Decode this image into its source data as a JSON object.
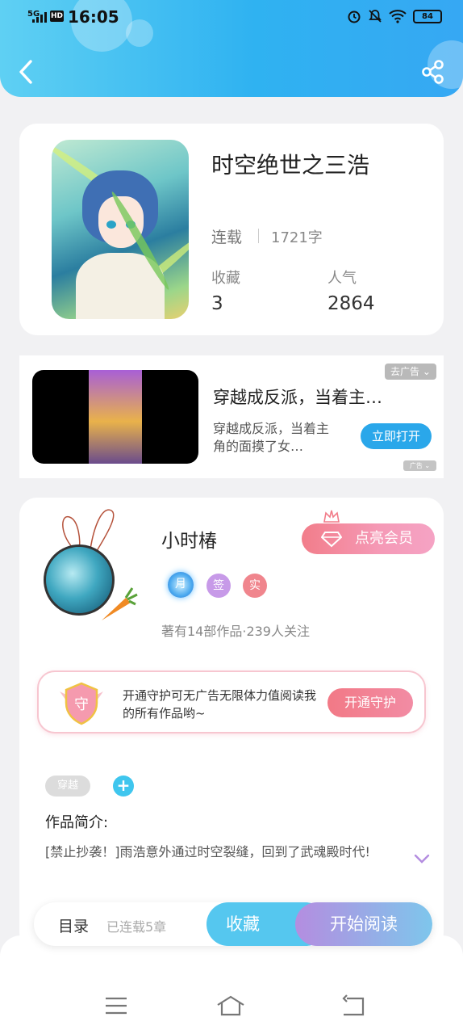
{
  "status_bar": {
    "network": "5G",
    "hd": "HD",
    "time": "16:05",
    "battery": "84"
  },
  "book": {
    "title": "时空绝世之三浩",
    "status": "连载",
    "word_count": "1721字",
    "favorites_label": "收藏",
    "favorites_value": "3",
    "popularity_label": "人气",
    "popularity_value": "2864"
  },
  "ad": {
    "title": "穿越成反派，当着主…",
    "description": "穿越成反派，当着主角的面摸了女…",
    "button": "立即打开",
    "close_label": "去广告",
    "mark": "广告"
  },
  "author": {
    "name": "小时椿",
    "vip_button": "点亮会员",
    "badges": [
      "月",
      "签",
      "实"
    ],
    "meta": "著有14部作品·239人关注",
    "guard_text": "开通守护可无广告无限体力值阅读我的所有作品哟~",
    "guard_button": "开通守护",
    "shield_char": "守",
    "tag": "穿越",
    "add_symbol": "+",
    "intro_label": "作品简介:",
    "intro_text": "[禁止抄袭！]雨浩意外通过时空裂缝，回到了武魂殿时代!"
  },
  "action_bar": {
    "toc": "目录",
    "toc_meta": "已连载5章",
    "favorite": "收藏",
    "read": "开始阅读"
  },
  "colors": {
    "header": "#2fb2f1",
    "accent_blue": "#55c7ef",
    "accent_pink": "#f27986"
  },
  "icons": [
    "back-icon",
    "share-icon",
    "wifi-icon",
    "alarm-icon",
    "mute-icon",
    "menu-icon",
    "home-icon",
    "return-icon"
  ]
}
